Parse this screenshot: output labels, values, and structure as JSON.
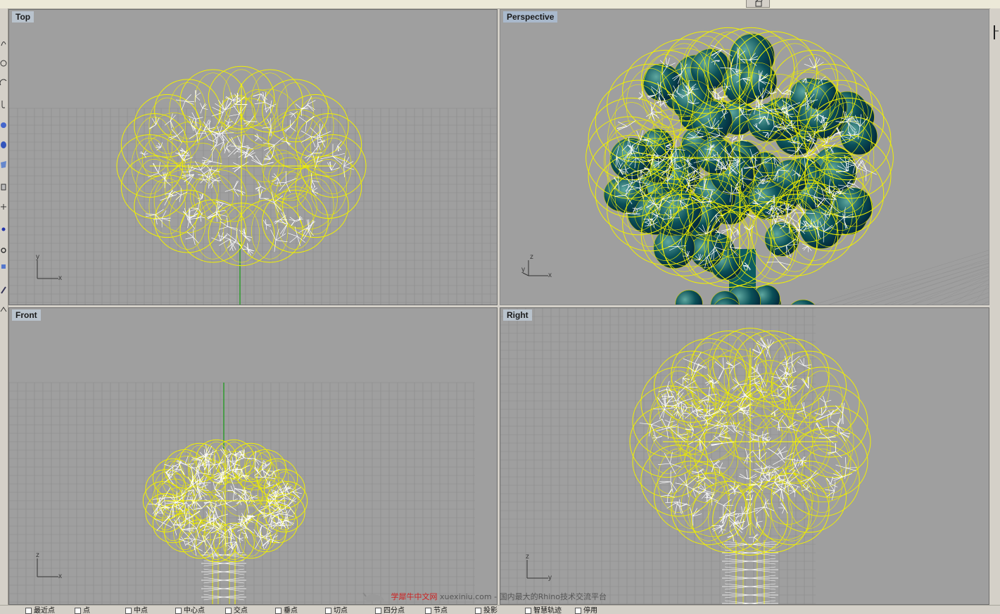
{
  "viewports": {
    "top": {
      "label": "Top",
      "axis_h": "x",
      "axis_v": "y"
    },
    "perspective": {
      "label": "Perspective",
      "axis_h": "x",
      "axis_v": "z",
      "axis_third": "y"
    },
    "front": {
      "label": "Front",
      "axis_h": "x",
      "axis_v": "z"
    },
    "right": {
      "label": "Right",
      "axis_h": "y",
      "axis_v": "z"
    }
  },
  "status": {
    "osnaps": [
      {
        "label": "最近点",
        "checked": false
      },
      {
        "label": "点",
        "checked": false
      },
      {
        "label": "中点",
        "checked": false
      },
      {
        "label": "中心点",
        "checked": false
      },
      {
        "label": "交点",
        "checked": false
      },
      {
        "label": "垂点",
        "checked": false
      },
      {
        "label": "切点",
        "checked": false
      },
      {
        "label": "四分点",
        "checked": false
      },
      {
        "label": "节点",
        "checked": false
      },
      {
        "label": "投影",
        "checked": false
      },
      {
        "label": "智慧轨迹",
        "checked": false
      },
      {
        "label": "停用",
        "checked": false
      }
    ]
  },
  "watermark": {
    "brand": "学犀牛中文网",
    "url": "xuexiniu.com",
    "slogan": "- 国内最大的Rhino技术交流平台"
  },
  "colors": {
    "viewport_bg": "#9f9f9f",
    "wire": "#ffff00",
    "points": "#ffffff",
    "shaded": "#0a4a4e",
    "green_axis": "#2e9a2e"
  }
}
